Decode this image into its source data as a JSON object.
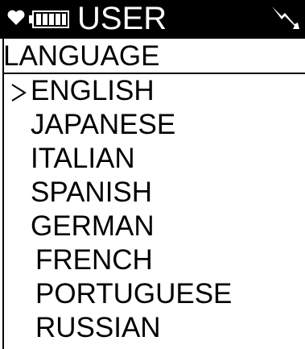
{
  "header": {
    "title": "USER",
    "left_icons": [
      "heart-icon",
      "battery-icon"
    ],
    "right_icon": "signal-icon"
  },
  "section": {
    "title": "LANGUAGE"
  },
  "menu": {
    "selected_index": 0,
    "cursor_icon": "chevron-right-icon",
    "items": [
      {
        "label": "ENGLISH"
      },
      {
        "label": "JAPANESE"
      },
      {
        "label": "ITALIAN"
      },
      {
        "label": "SPANISH"
      },
      {
        "label": "GERMAN"
      },
      {
        "label": "FRENCH"
      },
      {
        "label": "PORTUGUESE"
      },
      {
        "label": "RUSSIAN"
      }
    ]
  },
  "colors": {
    "background": "#ffffff",
    "foreground": "#000000",
    "header_bg": "#000000",
    "header_fg": "#ffffff"
  }
}
